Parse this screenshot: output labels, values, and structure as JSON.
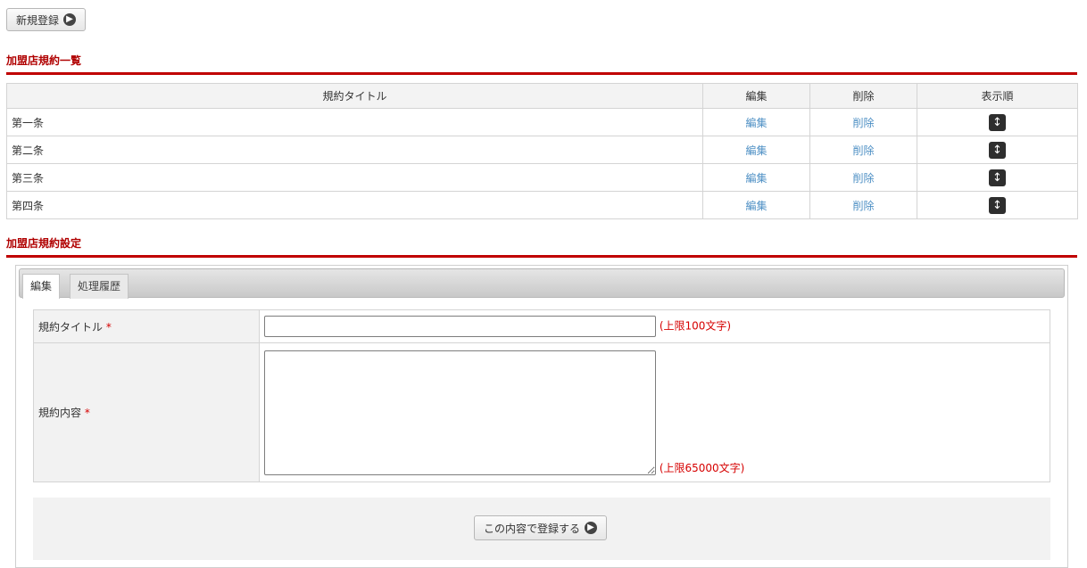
{
  "toolbar": {
    "new_label": "新規登録",
    "arrow_icon": "circle-arrow-right-icon"
  },
  "list_section": {
    "title": "加盟店規約一覧",
    "headers": [
      "規約タイトル",
      "編集",
      "削除",
      "表示順"
    ],
    "rows": [
      {
        "title": "第一条",
        "edit": "編集",
        "delete": "削除"
      },
      {
        "title": "第二条",
        "edit": "編集",
        "delete": "削除"
      },
      {
        "title": "第三条",
        "edit": "編集",
        "delete": "削除"
      },
      {
        "title": "第四条",
        "edit": "編集",
        "delete": "削除"
      }
    ],
    "sort_icon": "up-down-arrow-icon"
  },
  "setting_section": {
    "title": "加盟店規約設定",
    "tabs": [
      "編集",
      "処理履歴"
    ],
    "fields": {
      "title_label": "規約タイトル",
      "title_required": "*",
      "title_value": "",
      "title_limit": "(上限100文字)",
      "content_label": "規約内容",
      "content_required": "*",
      "content_value": "",
      "content_limit": "(上限65000文字)"
    },
    "submit_label": "この内容で登録する"
  },
  "colors": {
    "accent": "#c00000",
    "link": "#4d8fc4",
    "required": "#d60000"
  }
}
